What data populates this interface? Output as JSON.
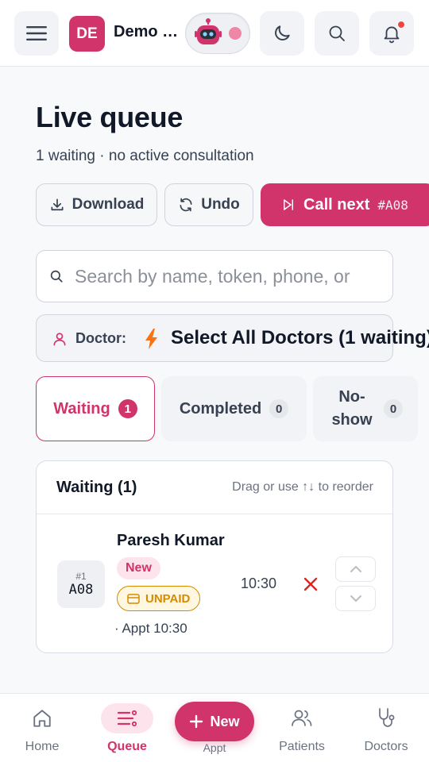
{
  "colors": {
    "primary": "#d0346b",
    "primary_soft": "#fde4ec",
    "unpaid": "#d68a00",
    "unpaid_bg": "#fff7e0",
    "danger": "#dc2626"
  },
  "header": {
    "menu_icon": "hamburger-menu-icon",
    "org_initials": "DE",
    "org_name": "Demo Clinic",
    "assistant_icon": "robot-icon",
    "theme_icon": "moon-icon",
    "search_icon": "search-icon",
    "notifications_icon": "bell-icon"
  },
  "page": {
    "title": "Live queue",
    "subtitle": "1 waiting · no active consultation"
  },
  "actions": {
    "download_label": "Download",
    "undo_label": "Undo",
    "call_next_label": "Call next",
    "call_next_token": "#A08"
  },
  "search": {
    "placeholder": "Search by name, token, phone, or",
    "value": ""
  },
  "doctor_filter": {
    "label": "Doctor:",
    "value": "Select All Doctors (1 waiting)"
  },
  "tabs": [
    {
      "label": "Waiting",
      "count": "1",
      "active": true
    },
    {
      "label": "Completed",
      "count": "0",
      "active": false
    },
    {
      "label": "No-show",
      "count": "0",
      "active": false
    }
  ],
  "queue": {
    "title": "Waiting (1)",
    "hint": "Drag or use ↑↓ to reorder",
    "rows": [
      {
        "position": "#1",
        "token": "A08",
        "name": "Paresh Kumar",
        "badge_new": "New",
        "badge_payment": "UNPAID",
        "appt": "· Appt 10:30",
        "time": "10:30"
      }
    ]
  },
  "bottom_nav": {
    "home": "Home",
    "queue": "Queue",
    "new_label": "New",
    "new_sub": "Appt",
    "patients": "Patients",
    "doctors": "Doctors"
  }
}
